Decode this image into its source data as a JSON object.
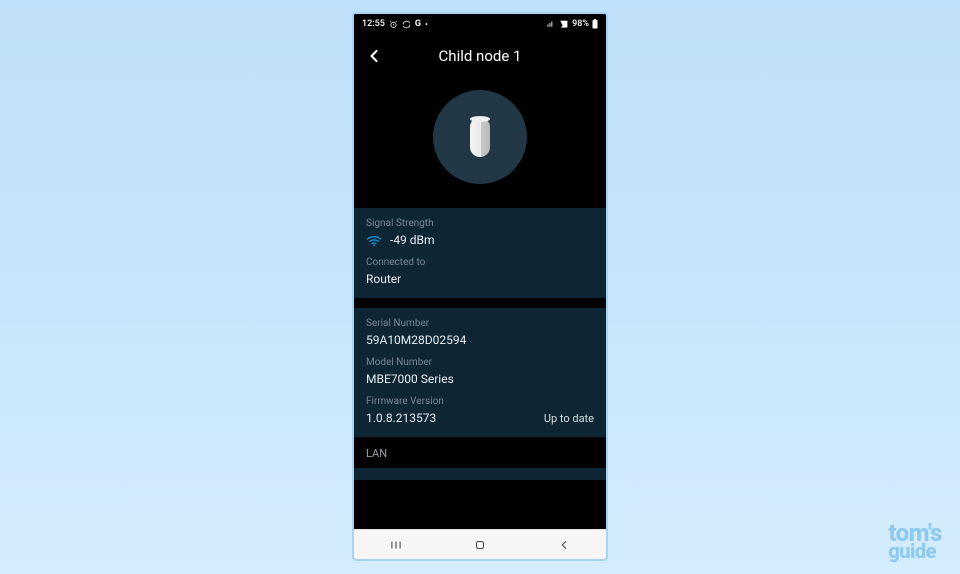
{
  "status": {
    "time": "12:55",
    "battery": "98%"
  },
  "header": {
    "title": "Child node 1"
  },
  "signal": {
    "label": "Signal Strength",
    "value": "-49 dBm"
  },
  "connected": {
    "label": "Connected to",
    "value": "Router"
  },
  "serial": {
    "label": "Serial Number",
    "value": "59A10M28D02594"
  },
  "model": {
    "label": "Model Number",
    "value": "MBE7000 Series"
  },
  "firmware": {
    "label": "Firmware Version",
    "value": "1.0.8.213573",
    "status": "Up to date"
  },
  "lan": {
    "header": "LAN"
  },
  "watermark": {
    "line1": "tom's",
    "line2": "guide"
  }
}
